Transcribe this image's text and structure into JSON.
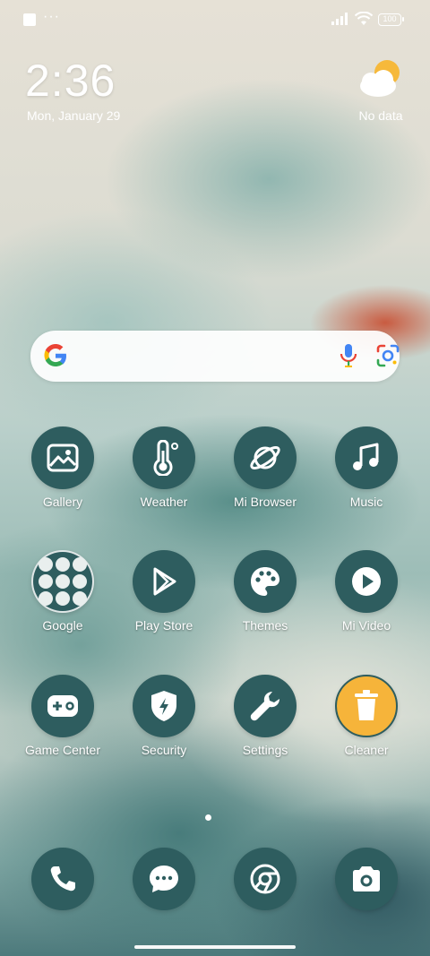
{
  "status_bar": {
    "notification_icons": [
      "square-icon",
      "more-dots-icon"
    ],
    "battery": "100",
    "icons": [
      "signal-icon",
      "wifi-icon",
      "battery-icon"
    ]
  },
  "clock_widget": {
    "time": "2:36",
    "date": "Mon, January 29"
  },
  "weather_widget": {
    "icon": "partly-cloudy-icon",
    "text": "No data"
  },
  "search_bar": {
    "icons": [
      "google-g-icon",
      "microphone-icon",
      "google-lens-icon"
    ]
  },
  "apps": [
    {
      "label": "Gallery",
      "icon": "gallery-icon"
    },
    {
      "label": "Weather",
      "icon": "thermometer-icon"
    },
    {
      "label": "Mi Browser",
      "icon": "planet-icon"
    },
    {
      "label": "Music",
      "icon": "music-note-icon"
    },
    {
      "label": "Google",
      "icon": "folder-icon"
    },
    {
      "label": "Play Store",
      "icon": "play-store-icon"
    },
    {
      "label": "Themes",
      "icon": "palette-icon"
    },
    {
      "label": "Mi Video",
      "icon": "play-circle-icon"
    },
    {
      "label": "Game Center",
      "icon": "gamepad-icon"
    },
    {
      "label": "Security",
      "icon": "shield-icon"
    },
    {
      "label": "Settings",
      "icon": "wrench-icon"
    },
    {
      "label": "Cleaner",
      "icon": "trash-icon"
    }
  ],
  "dock": [
    {
      "icon": "phone-icon"
    },
    {
      "icon": "messaging-icon"
    },
    {
      "icon": "chrome-icon"
    },
    {
      "icon": "camera-icon"
    }
  ],
  "colors": {
    "icon_background": "#2e5d5f",
    "cleaner_accent": "#f6b43a"
  }
}
